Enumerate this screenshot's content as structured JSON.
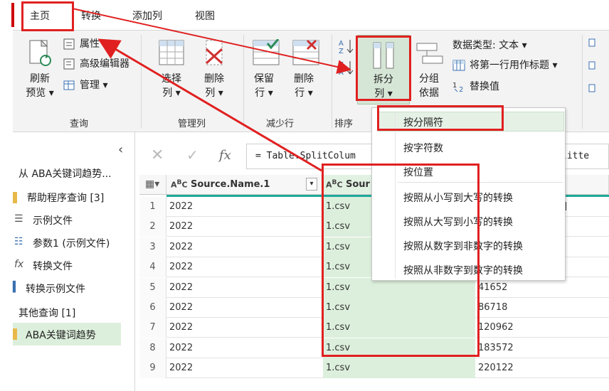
{
  "tabs": [
    {
      "label": "主页"
    },
    {
      "label": "转换"
    },
    {
      "label": "添加列"
    },
    {
      "label": "视图"
    }
  ],
  "ribbon": {
    "query_group": {
      "label": "查询",
      "refresh": "刷新",
      "preview": "预览 ▾",
      "properties": "属性",
      "advanced_editor": "高级编辑器",
      "manage": "管理 ▾"
    },
    "manage_cols_group": {
      "label": "管理列",
      "choose": "选择",
      "choose2": "列 ▾",
      "remove": "删除",
      "remove2": "列 ▾"
    },
    "reduce_rows_group": {
      "label": "减少行",
      "keep": "保留",
      "keep2": "行 ▾",
      "remove": "删除",
      "remove2": "行 ▾"
    },
    "sort_group": {
      "label": "排序"
    },
    "split": {
      "line1": "拆分",
      "line2": "列 ▾"
    },
    "group_by": {
      "line1": "分组",
      "line2": "依据"
    },
    "datatype": "数据类型: 文本 ▾",
    "first_row_header": "将第一行用作标题 ▾",
    "replace_values": "替换值"
  },
  "split_menu": {
    "items": [
      "按分隔符",
      "按字符数",
      "按位置",
      "按照从小写到大写的转换",
      "按照从大写到小写的转换",
      "按照从数字到非数字的转换",
      "按照从非数字到数字的转换"
    ]
  },
  "left_pane": {
    "items": [
      "从 ABA关键词趋势...",
      "帮助程序查询 [3]",
      "示例文件",
      "参数1 (示例文件)",
      "转换文件",
      "转换示例文件",
      "其他查询 [1]",
      "ABA关键词趋势"
    ]
  },
  "formula": {
    "text": "= Table.SplitColum",
    "text_tail": "litte"
  },
  "grid": {
    "col1_header": "Source.Name.1",
    "col2_header": "Sour",
    "row_numbers": [
      "1",
      "2",
      "3",
      "4",
      "5",
      "6",
      "7",
      "8",
      "9"
    ],
    "col1": [
      "2022",
      "2022",
      "2022",
      "2022",
      "2022",
      "2022",
      "2022",
      "2022",
      "2022"
    ],
    "col2": [
      "1.csv",
      "1.csv",
      "1.csv",
      "1.csv",
      "1.csv",
      "1.csv",
      "1.csv",
      "1.csv",
      "1.csv"
    ],
    "col3": [
      "",
      "",
      "",
      "",
      "41652",
      "86718",
      "120962",
      "183572",
      "220122"
    ],
    "col3_row1_partial": "]"
  },
  "colors": {
    "annotation_red": "#e02020",
    "teal_header_line": "#1fa99a",
    "highlight_green": "#dcefdc"
  }
}
